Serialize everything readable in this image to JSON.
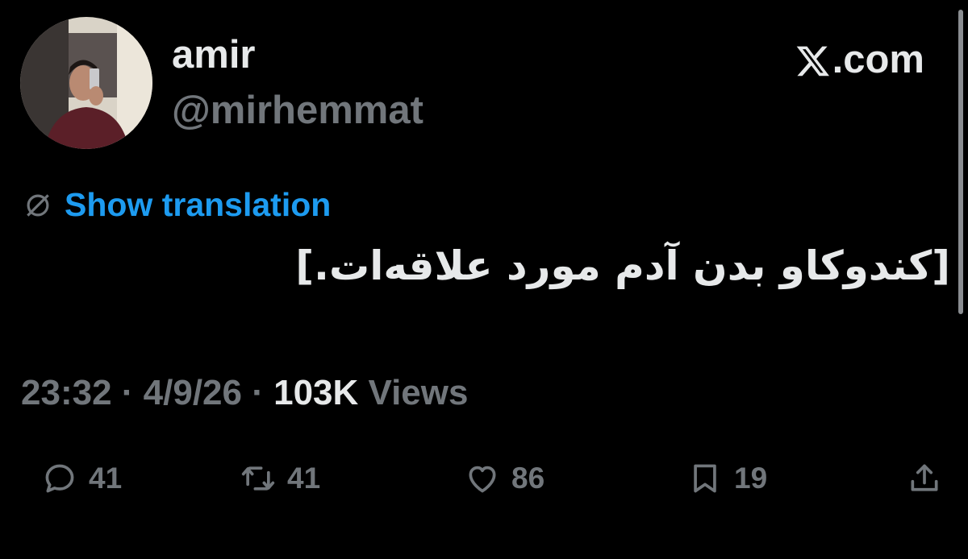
{
  "author": {
    "display_name": "amir",
    "handle": "@mirhemmat",
    "avatar": "profile-photo"
  },
  "site_label": "X.com",
  "translation": {
    "icon": "globe-icon",
    "link_label": "Show translation"
  },
  "tweet": {
    "text": "[کندوکاو بدن آدم مورد علاقه‌ات.]"
  },
  "meta": {
    "time": "23:32",
    "separator1": " · ",
    "date": "4/9/26",
    "separator2": " · ",
    "views_count": "103K",
    "views_label": " Views"
  },
  "actions": {
    "replies": {
      "icon": "reply-icon",
      "count": "41"
    },
    "reposts": {
      "icon": "repost-icon",
      "count": "41"
    },
    "likes": {
      "icon": "heart-icon",
      "count": "86"
    },
    "bookmarks": {
      "icon": "bookmark-icon",
      "count": "19"
    },
    "share": {
      "icon": "share-icon"
    }
  },
  "colors": {
    "background": "#000000",
    "text_primary": "#e7e9ea",
    "text_secondary": "#71767b",
    "link": "#1d9bf0"
  }
}
